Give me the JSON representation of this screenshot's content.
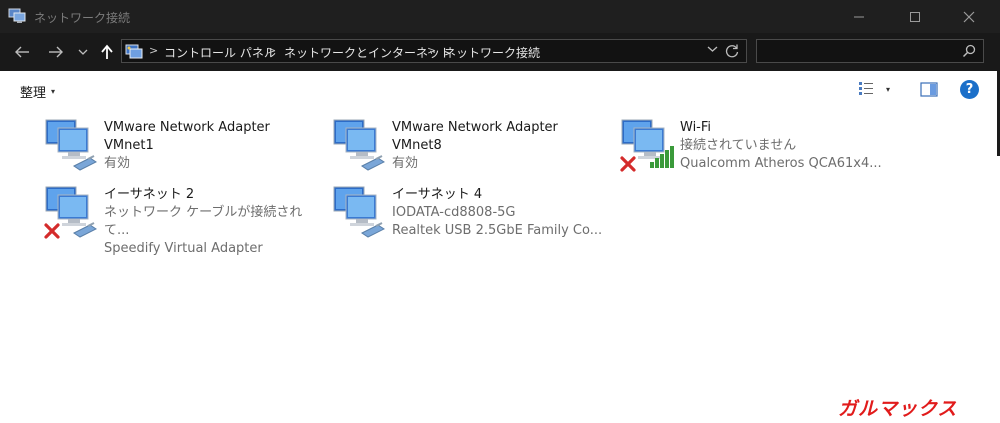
{
  "window": {
    "title": "ネットワーク接続",
    "icon": "network-connections-icon",
    "controls": [
      "minimize-icon",
      "maximize-icon",
      "close-icon"
    ]
  },
  "nav": {
    "back": "arrow-left-icon",
    "forward": "arrow-right-icon",
    "recent": "chevron-down-icon",
    "up": "arrow-up-icon"
  },
  "address": {
    "icon": "control-panel-icon",
    "crumbs": [
      "コントロール パネル",
      "ネットワークとインターネット",
      "ネットワーク接続"
    ],
    "separator": ">"
  },
  "search": {
    "value": "",
    "icon": "search-icon"
  },
  "cmdbar": {
    "organize_label": "整理",
    "organize_caret": "▾",
    "view_caret": "▾",
    "help_label": "?"
  },
  "items": [
    {
      "name": "VMware Network Adapter VMnet1",
      "line1": "VMware Network Adapter",
      "line2": "VMnet1",
      "status": "有効",
      "device": "",
      "state": "enabled"
    },
    {
      "name": "VMware Network Adapter VMnet8",
      "line1": "VMware Network Adapter",
      "line2": "VMnet8",
      "status": "有効",
      "device": "",
      "state": "enabled"
    },
    {
      "name": "Wi-Fi",
      "line1": "Wi-Fi",
      "line2": "",
      "status": "接続されていません",
      "device": "Qualcomm Atheros QCA61x4...",
      "state": "disconnected-wifi"
    },
    {
      "name": "イーサネット 2",
      "line1": "イーサネット 2",
      "line2": "",
      "status": "ネットワーク ケーブルが接続されて...",
      "device": "Speedify Virtual Adapter",
      "state": "disconnected"
    },
    {
      "name": "イーサネット 4",
      "line1": "イーサネット 4",
      "line2": "",
      "status": "IODATA-cd8808-5G",
      "device": "Realtek USB 2.5GbE Family Co...",
      "state": "connected"
    }
  ],
  "watermark": "ガルマックス",
  "colors": {
    "titlebar": "#1f1f1f",
    "navbar": "#191919",
    "accent_help": "#1b6fc9",
    "error_x": "#d42b2b",
    "wifi_bars": "#3a9a3a",
    "watermark": "#e11b1b"
  }
}
